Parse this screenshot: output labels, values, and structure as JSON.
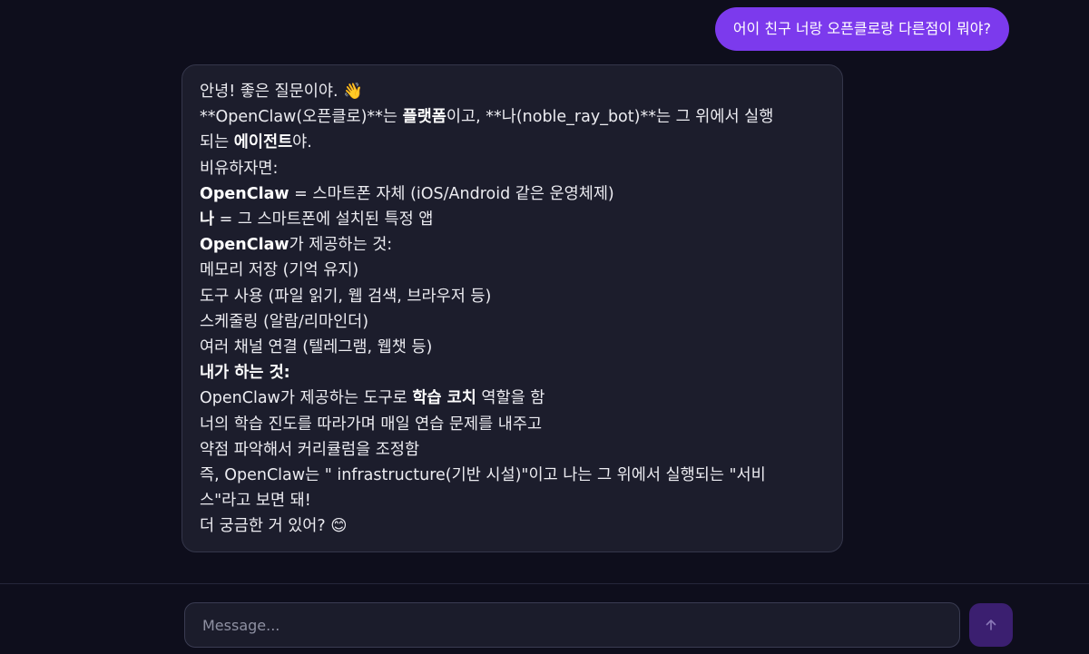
{
  "messages": {
    "user": {
      "text": "어이 친구 너랑 오픈클로랑 다른점이 뭐야?"
    },
    "bot": {
      "line_01": "안녕! 좋은 질문이야. 👋",
      "line_02_a": "**OpenClaw(오픈클로)**는 ",
      "line_02_b": "플랫폼",
      "line_02_c": "이고, **나(noble_ray_bot)**는 그 위에서 실행",
      "line_03_a": "되는 ",
      "line_03_b": "에이전트",
      "line_03_c": "야.",
      "line_04": "비유하자면:",
      "line_05_a": "OpenClaw",
      "line_05_b": " = 스마트폰 자체 (iOS/Android 같은 운영체제)",
      "line_06_a": "나",
      "line_06_b": " = 그 스마트폰에 설치된 특정 앱",
      "line_07_a": "OpenClaw",
      "line_07_b": "가 제공하는 것:",
      "line_08": "메모리 저장 (기억 유지)",
      "line_09": "도구 사용 (파일 읽기, 웹 검색, 브라우저 등)",
      "line_10": "스케줄링 (알람/리마인더)",
      "line_11": "여러 채널 연결 (텔레그램, 웹챗 등)",
      "line_12": "내가 하는 것:",
      "line_13_a": "OpenClaw가 제공하는 도구로 ",
      "line_13_b": "학습 코치",
      "line_13_c": " 역할을 함",
      "line_14": "너의 학습 진도를 따라가며 매일 연습 문제를 내주고",
      "line_15": "약점 파악해서 커리큘럼을 조정함",
      "line_16": "즉, OpenClaw는 \" infrastructure(기반 시설)\"이고 나는 그 위에서 실행되는 \"서비",
      "line_17": "스\"라고 보면 돼!",
      "line_18": "더 궁금한 거 있어? 😊"
    }
  },
  "composer": {
    "placeholder": "Message...",
    "send_icon": "arrow-up-icon"
  },
  "colors": {
    "background": "#0e0e1c",
    "user_bubble": "#7c3aed",
    "bot_bubble": "#1c1d2c",
    "send_button": "#3b1f70"
  }
}
